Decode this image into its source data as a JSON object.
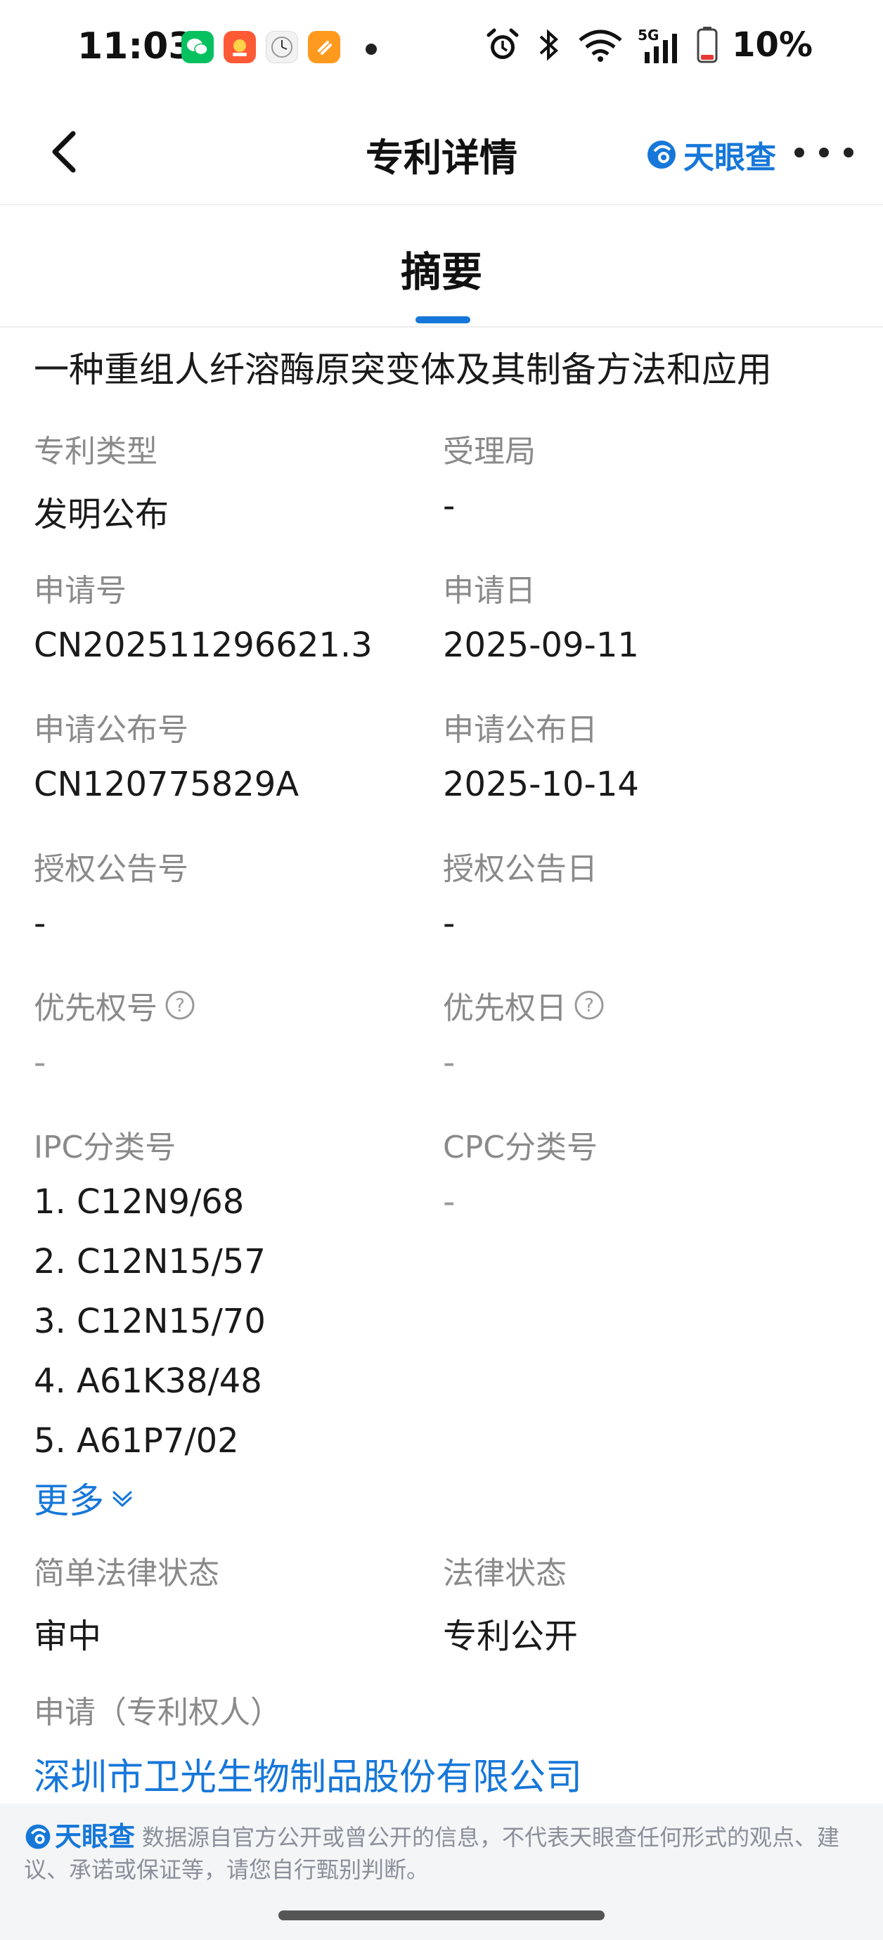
{
  "status_bar": {
    "time": "11:03",
    "battery": "10%",
    "network": "5G",
    "app_icons": [
      "wechat-icon",
      "game-app-icon",
      "clock-app-icon",
      "orange-app-icon"
    ],
    "indicators": [
      "alarm-icon",
      "bluetooth-icon",
      "wifi-icon",
      "signal-icon",
      "battery-icon"
    ]
  },
  "nav": {
    "title": "专利详情",
    "brand": "天眼查",
    "brand_color": "#1677d9"
  },
  "tab": {
    "active_label": "摘要",
    "accent_color": "#1677d9"
  },
  "patent": {
    "title": "一种重组人纤溶酶原突变体及其制备方法和应用",
    "fields": {
      "patent_type": {
        "label": "专利类型",
        "value": "发明公布"
      },
      "office": {
        "label": "受理局",
        "value": "-"
      },
      "app_no": {
        "label": "申请号",
        "value": "CN202511296621.3"
      },
      "app_date": {
        "label": "申请日",
        "value": "2025-09-11"
      },
      "pub_no": {
        "label": "申请公布号",
        "value": "CN120775829A"
      },
      "pub_date": {
        "label": "申请公布日",
        "value": "2025-10-14"
      },
      "grant_no": {
        "label": "授权公告号",
        "value": "-"
      },
      "grant_date": {
        "label": "授权公告日",
        "value": "-"
      },
      "priority_no": {
        "label": "优先权号",
        "value": "-"
      },
      "priority_date": {
        "label": "优先权日",
        "value": "-"
      },
      "ipc": {
        "label": "IPC分类号",
        "items": [
          "1. C12N9/68",
          "2. C12N15/57",
          "3. C12N15/70",
          "4. A61K38/48",
          "5. A61P7/02"
        ],
        "more_label": "更多"
      },
      "cpc": {
        "label": "CPC分类号",
        "value": "-"
      },
      "simple_legal_status": {
        "label": "简单法律状态",
        "value": "审中"
      },
      "legal_status": {
        "label": "法律状态",
        "value": "专利公开"
      },
      "applicant": {
        "label": "申请（专利权人）",
        "value": "深圳市卫光生物制品股份有限公司"
      }
    }
  },
  "footer": {
    "brand": "天眼查",
    "text": "数据源自官方公开或曾公开的信息，不代表天眼查任何形式的观点、建议、承诺或保证等，请您自行甄别判断。"
  }
}
